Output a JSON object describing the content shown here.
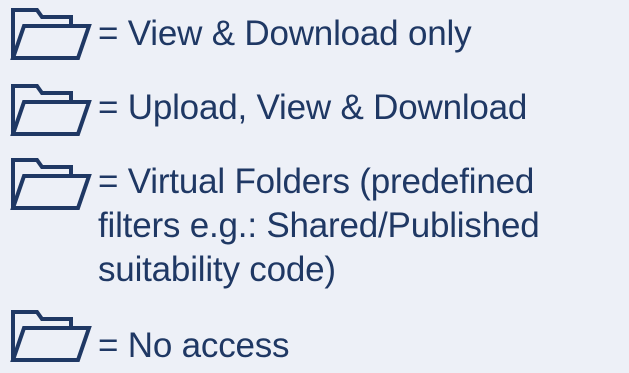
{
  "legend": {
    "items": [
      {
        "icon": "folder-open-icon",
        "text": "= View & Download only"
      },
      {
        "icon": "folder-open-icon",
        "text": "= Upload, View & Download"
      },
      {
        "icon": "folder-open-icon",
        "lines": [
          "= Virtual Folders (predefined",
          "filters e.g.: Shared/Published",
          "suitability code)"
        ]
      },
      {
        "icon": "folder-open-icon",
        "text": "= No access"
      }
    ],
    "colors": {
      "folder_stroke": "#1f3864",
      "text": "#1f3864",
      "background": "#edf0f7"
    }
  }
}
